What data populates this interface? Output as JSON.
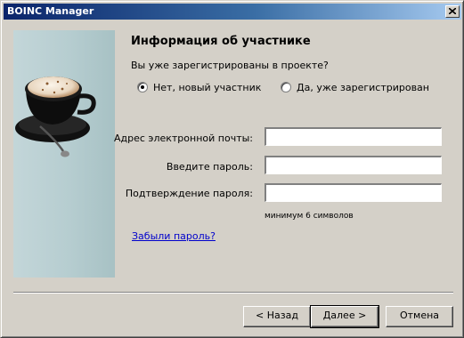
{
  "window": {
    "title": "BOINC Manager"
  },
  "page": {
    "heading": "Информация об участнике",
    "question": "Вы уже зарегистрированы в проекте?",
    "radio_new": {
      "label": "Нет, новый участник",
      "checked": true
    },
    "radio_existing": {
      "label": "Да, уже зарегистрирован",
      "checked": false
    },
    "email_label": "Адрес электронной почты:",
    "email_value": "",
    "password_label": "Введите пароль:",
    "password_value": "",
    "confirm_label": "Подтверждение пароля:",
    "confirm_value": "",
    "password_hint": "минимум 6 символов",
    "forgot_link": "Забыли пароль?"
  },
  "buttons": {
    "back": "< Назад",
    "next": "Далее >",
    "cancel": "Отмена"
  },
  "icons": {
    "close": "close-icon",
    "side_image": "coffee-cup-image"
  }
}
